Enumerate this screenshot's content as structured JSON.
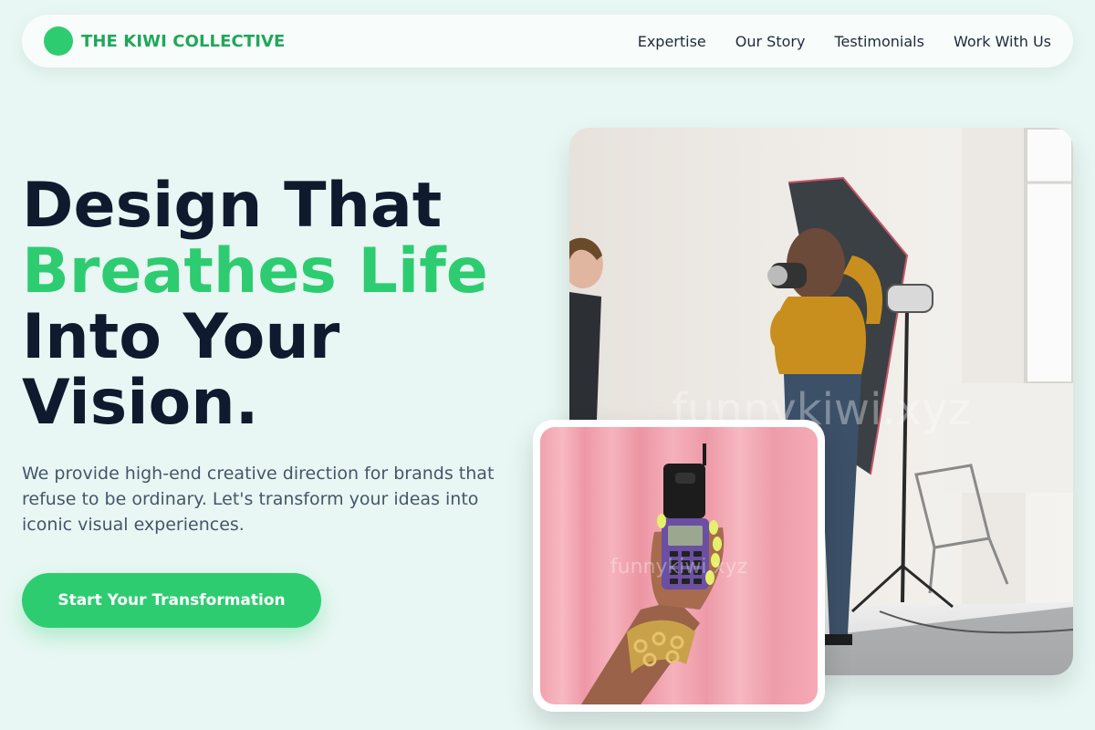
{
  "brand": {
    "name": "THE KIWI COLLECTIVE",
    "logo_color": "#2ecc71"
  },
  "nav": {
    "links": [
      "Expertise",
      "Our Story",
      "Testimonials",
      "Work With Us"
    ]
  },
  "hero": {
    "headline_line1": "Design That",
    "headline_accent": "Breathes Life",
    "headline_line3": "Into Your",
    "headline_line4": "Vision.",
    "description": "We provide high-end creative direction for brands that refuse to be ordinary. Let's transform your ideas into iconic visual experiences.",
    "cta_label": "Start Your Transformation"
  },
  "images": {
    "main_watermark": "funnykiwi.xyz",
    "small_watermark": "funnykiwi.xyz"
  },
  "colors": {
    "accent": "#2ecc71",
    "heading": "#0f1a2e",
    "background": "#e8f7f3"
  }
}
